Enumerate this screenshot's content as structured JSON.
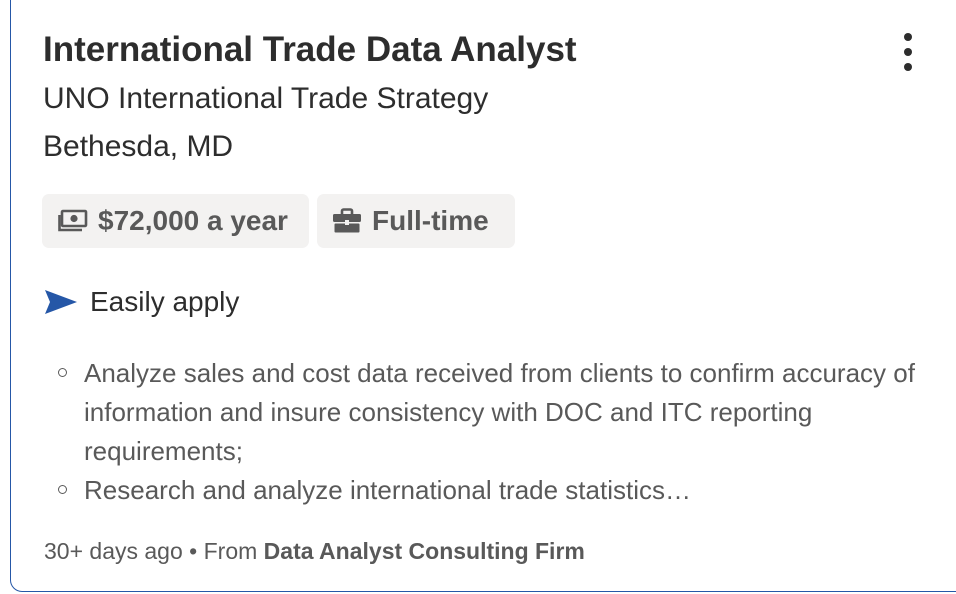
{
  "job": {
    "title": "International Trade Data Analyst",
    "company": "UNO International Trade Strategy",
    "location": "Bethesda, MD"
  },
  "attributes": [
    {
      "icon": "money-icon",
      "label": "$72,000 a year"
    },
    {
      "icon": "briefcase-icon",
      "label": "Full-time"
    }
  ],
  "apply": {
    "icon": "send-arrow-icon",
    "label": "Easily apply"
  },
  "snippet": [
    "Analyze sales and cost data received from clients to confirm accuracy of information and insure consistency with DOC and ITC reporting requirements;",
    "Research and analyze international trade statistics…"
  ],
  "footer": {
    "age": "30+ days ago",
    "separator": "•",
    "from_label": "From",
    "firm": "Data Analyst Consulting Firm"
  },
  "colors": {
    "accent": "#2557a7",
    "text": "#2d2d2d",
    "muted": "#595959",
    "chip_bg": "#f3f2f1"
  }
}
